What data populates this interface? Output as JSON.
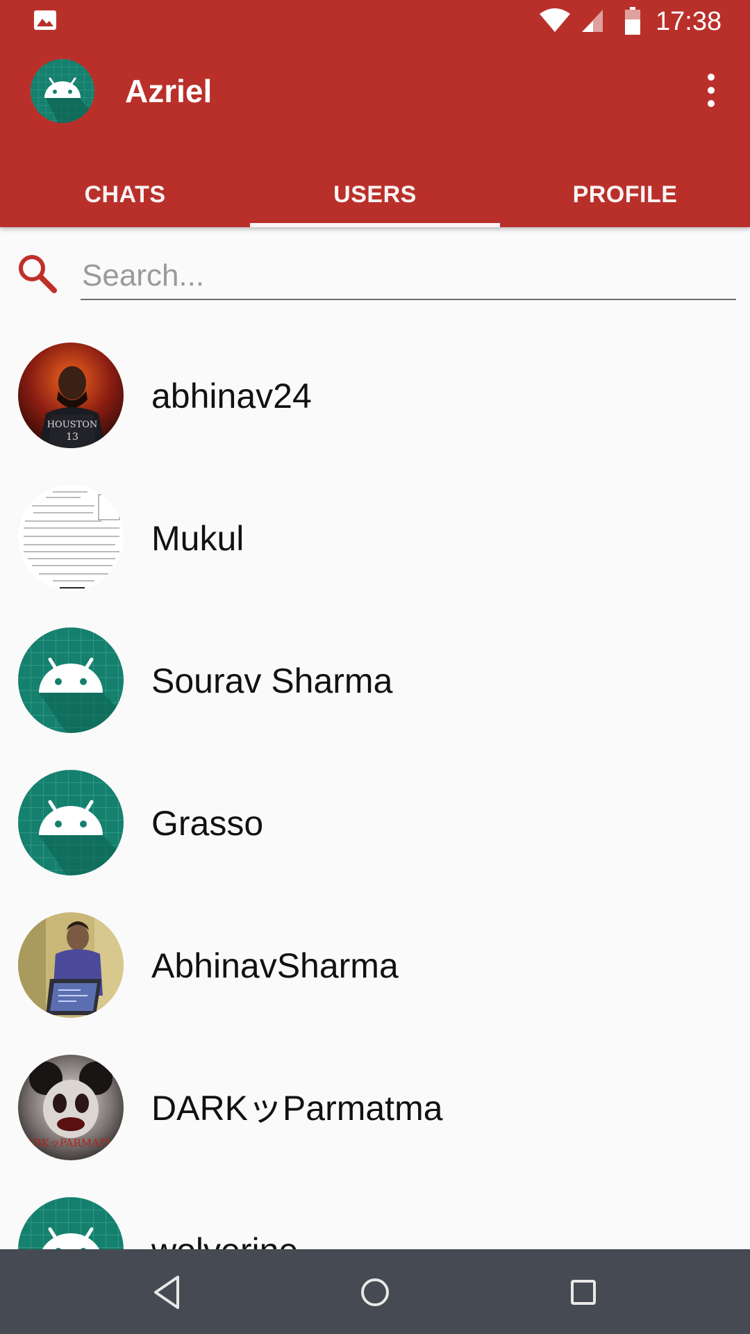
{
  "status_bar": {
    "time": "17:38"
  },
  "app_bar": {
    "title": "Azriel"
  },
  "tabs": [
    {
      "label": "CHATS",
      "active": false
    },
    {
      "label": "USERS",
      "active": true
    },
    {
      "label": "PROFILE",
      "active": false
    }
  ],
  "search": {
    "placeholder": "Search...",
    "value": ""
  },
  "users": [
    {
      "name": "abhinav24",
      "avatar": "photo-basketball-player"
    },
    {
      "name": "Mukul",
      "avatar": "photo-document"
    },
    {
      "name": "Sourav Sharma",
      "avatar": "android-default"
    },
    {
      "name": "Grasso",
      "avatar": "android-default"
    },
    {
      "name": "AbhinavSharma",
      "avatar": "photo-person-laptop"
    },
    {
      "name": "DARKッParmatma",
      "avatar": "photo-dark-mouse"
    },
    {
      "name": "wolverine",
      "avatar": "android-default"
    }
  ],
  "colors": {
    "primary": "#b9302b",
    "android_teal": "#14806d",
    "navbar": "#454a53"
  },
  "icons": [
    "image-icon",
    "wifi-icon",
    "signal-icon",
    "battery-icon",
    "more-vert-icon",
    "search-icon",
    "back-icon",
    "home-icon",
    "recents-icon"
  ]
}
